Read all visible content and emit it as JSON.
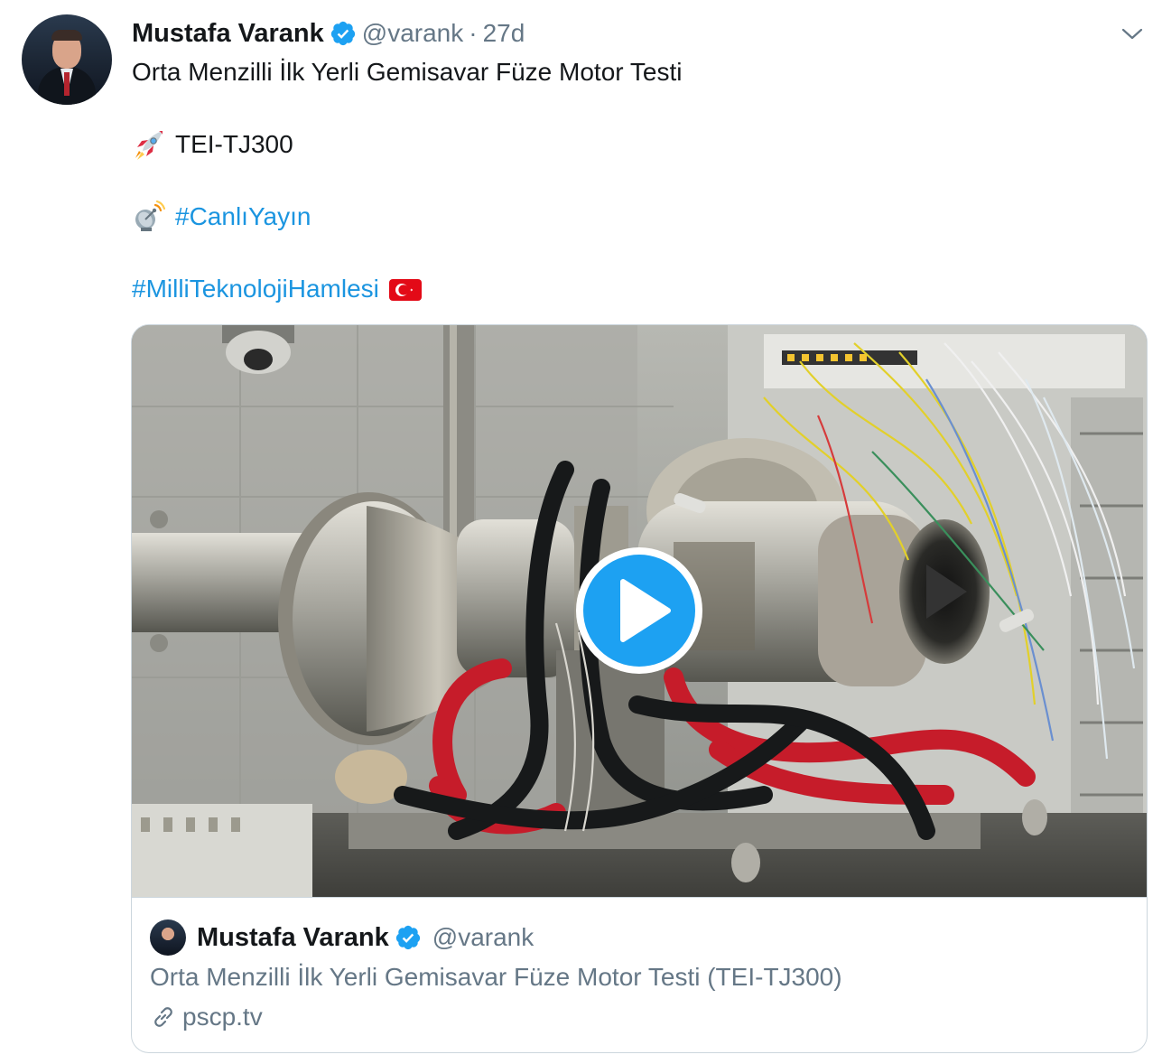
{
  "author": {
    "name": "Mustafa Varank",
    "handle": "@varank",
    "separator": "·",
    "time": "27d",
    "verified": true
  },
  "tweet": {
    "title_line": "Orta Menzilli İlk Yerli Gemisavar Füze Motor Testi",
    "rocket_emoji": "rocket-emoji",
    "product_line": "TEI-TJ300",
    "satellite_emoji": "satellite-antenna-emoji",
    "live_hashtag": "#CanlıYayın",
    "tech_hashtag": "#MilliTeknolojiHamlesi",
    "flag_emoji": "turkey-flag-emoji"
  },
  "card": {
    "author_name": "Mustafa Varank",
    "author_handle": "@varank",
    "description": "Orta Menzilli İlk Yerli Gemisavar Füze Motor Testi (TEI-TJ300)",
    "domain": "pscp.tv"
  },
  "colors": {
    "link_blue": "#1b95e0",
    "verified_blue": "#1da1f2",
    "secondary_text": "#657786",
    "primary_text": "#14171a",
    "border": "#ccd6dd"
  }
}
